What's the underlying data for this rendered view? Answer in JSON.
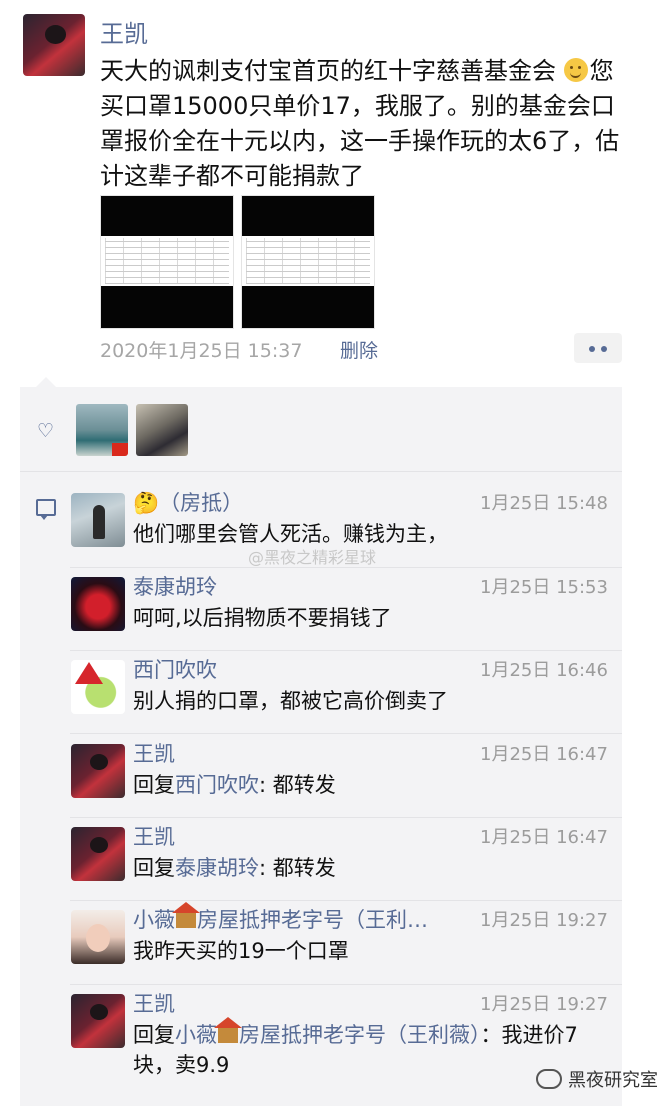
{
  "post": {
    "author": "王凯",
    "text_line1": "天大的讽刺支付宝首页的红十字慈善基金会",
    "text_emoji": "smile-emoji",
    "text_rest": "您买口罩15000只单价17，我服了。别的基金会口罩报价全在十元以内，这一手操作玩的太6了，估计这辈子都不可能捐款了",
    "time": "2020年1月25日 15:37",
    "delete_label": "删除"
  },
  "likes": {
    "icon": "heart-icon",
    "count_avatars": 2
  },
  "watermark": "@黑夜之精彩星球",
  "comments": [
    {
      "name": "🤔（房抵）",
      "time": "1月25日 15:48",
      "text": "他们哪里会管人死活。赚钱为主，",
      "avatar": "bald"
    },
    {
      "name": "泰康胡玲",
      "time": "1月25日 15:53",
      "text": "呵呵,以后捐物质不要捐钱了",
      "avatar": "heart"
    },
    {
      "name": "西门吹吹",
      "time": "1月25日 16:46",
      "text": "别人捐的口罩，都被它高价倒卖了",
      "avatar": "xmas"
    },
    {
      "name": "王凯",
      "time": "1月25日 16:47",
      "reply_prefix": "回复",
      "reply_to": "西门吹吹",
      "text": ": 都转发",
      "avatar": "wk"
    },
    {
      "name": "王凯",
      "time": "1月25日 16:47",
      "reply_prefix": "回复",
      "reply_to": "泰康胡玲",
      "text": ": 都转发",
      "avatar": "wk"
    },
    {
      "name_a": "小薇",
      "name_b": "房屋抵押老字号（王利…",
      "time": "1月25日 19:27",
      "text": "我昨天买的19一个口罩",
      "avatar": "girl"
    },
    {
      "name": "王凯",
      "time": "1月25日 19:27",
      "reply_prefix": "回复",
      "reply_to_a": "小薇",
      "reply_to_b": "房屋抵押老字号（王利薇）",
      "text": "：我进价7块，卖9.9",
      "avatar": "wk"
    }
  ],
  "brand": "黑夜研究室",
  "colors": {
    "link": "#576b95",
    "panel": "#f3f3f5",
    "meta": "#a6a6a6"
  }
}
